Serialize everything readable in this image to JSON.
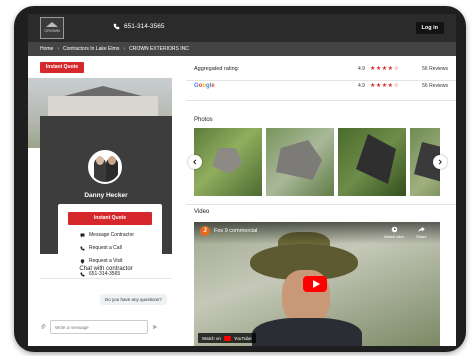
{
  "header": {
    "logo_text": "CROWN",
    "phone": "651-314-3565",
    "login_label": "Log in"
  },
  "breadcrumb": {
    "items": [
      "Home",
      "Contractors In Lake Elmo",
      "CROWN EXTERIORS INC"
    ]
  },
  "left": {
    "instant_quote_label": "Instant Quote",
    "contractor_name": "Danny Hecker",
    "card_quote_label": "Instant Quote",
    "actions": [
      {
        "icon": "chat-bubble-icon",
        "label": "Message Contractor"
      },
      {
        "icon": "phone-icon",
        "label": "Request a Call"
      },
      {
        "icon": "pin-icon",
        "label": "Request a Visit"
      },
      {
        "icon": "phone-icon",
        "label": "651-314-3565"
      }
    ],
    "chat": {
      "title": "Chat with contractor",
      "bubble": "Do you have any questions?",
      "placeholder": "Write a message"
    }
  },
  "right": {
    "aggregated_label": "Aggregated rating:",
    "aggregated_score": "4.9",
    "aggregated_stars": "★★★★☆",
    "aggregated_reviews": "56 Reviews",
    "google_label": "Google",
    "google_score": "4.9",
    "google_stars": "★★★★☆",
    "google_reviews": "56 Reviews",
    "photos_label": "Photos",
    "video_label": "Video",
    "video": {
      "avatar_letter": "J",
      "title": "Fox 9 commercial",
      "watch_later": "Watch later",
      "share": "Share",
      "watch_on": "Watch on",
      "youtube": "YouTube"
    }
  },
  "colors": {
    "accent_red": "#d6282c",
    "header_dark": "#2b2b2b",
    "card_dark": "#3d3d3d"
  }
}
